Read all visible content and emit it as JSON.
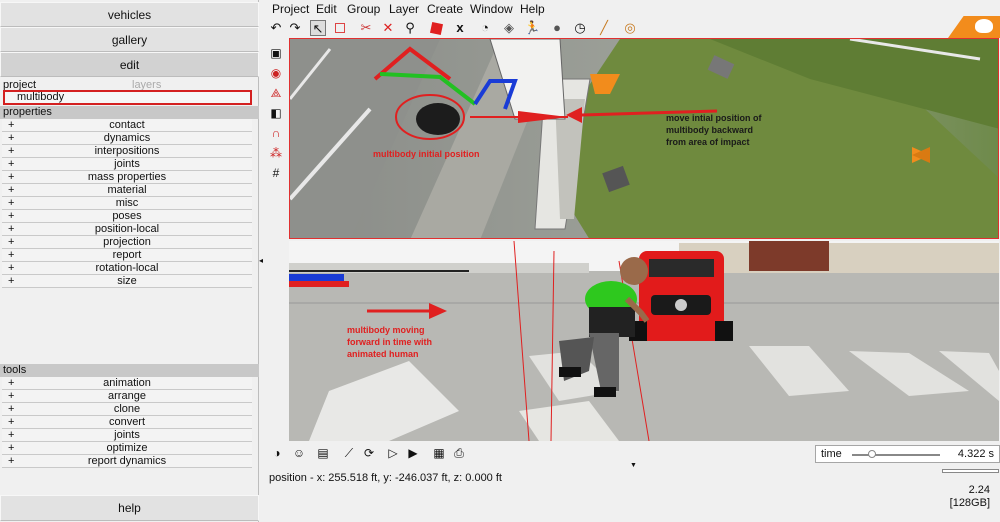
{
  "left_panel": {
    "buttons": {
      "vehicles": "vehicles",
      "gallery": "gallery",
      "edit": "edit",
      "help": "help"
    },
    "tabs": {
      "project": "project",
      "layers": "layers"
    },
    "selected_item": "multibody",
    "properties_header": "properties",
    "properties": [
      "contact",
      "dynamics",
      "interpositions",
      "joints",
      "mass properties",
      "material",
      "misc",
      "poses",
      "position-local",
      "projection",
      "report",
      "rotation-local",
      "size"
    ],
    "tools_header": "tools",
    "tools": [
      "animation",
      "arrange",
      "clone",
      "convert",
      "joints",
      "optimize",
      "report dynamics"
    ],
    "expand_symbol": "+"
  },
  "menu": [
    "Project",
    "Edit",
    "Group",
    "Layer",
    "Create",
    "Window",
    "Help"
  ],
  "viewport_top": {
    "annotation_left": "multibody initial position",
    "annotation_right": [
      "move intial position of",
      "multibody backward",
      "from area of impact"
    ]
  },
  "viewport_bottom": {
    "annotation": [
      "multibody moving",
      "forward in time with",
      "animated human"
    ]
  },
  "status": {
    "time_label": "time",
    "time_value": "4.322 s",
    "position": "position - x: 255.518 ft, y: -246.037 ft, z: 0.000 ft",
    "version": "2.24",
    "memory": "[128GB]"
  },
  "colors": {
    "annotation_red": "#e02020",
    "selection_red": "#d42020",
    "brand_orange": "#f28c1c"
  }
}
